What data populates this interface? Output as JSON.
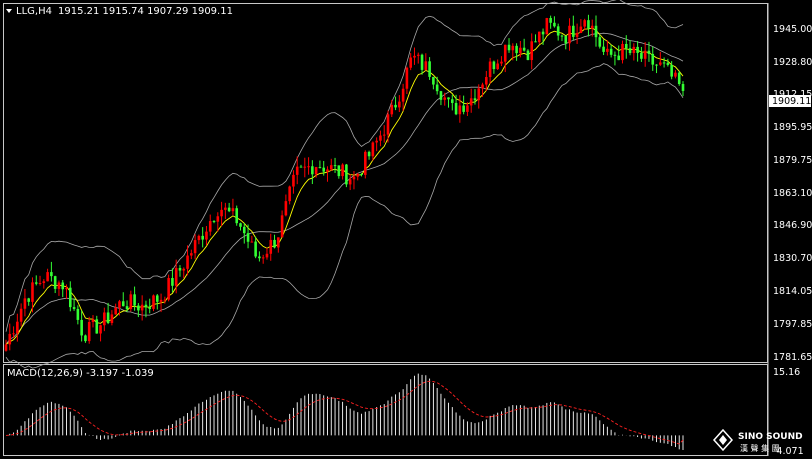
{
  "main_header": {
    "symbol_label": "LLG,H4",
    "ohlc": "1915.21 1915.74 1907.29 1909.11"
  },
  "price_axis": {
    "ticks": [
      "1945.00",
      "1928.80",
      "1912.15",
      "1895.95",
      "1879.75",
      "1863.10",
      "1846.90",
      "1830.70",
      "1814.05",
      "1797.85",
      "1781.65"
    ],
    "current_price": "1909.11"
  },
  "macd": {
    "label": "MACD(12,26,9) -3.197 -1.039",
    "axis_top": "15.16",
    "axis_bottom": "-4.071"
  },
  "logo": {
    "brand": "SINO SOUND",
    "sub": "漢 聲 集 團"
  },
  "colors": {
    "bull": "#ff0000",
    "bear": "#33ff33",
    "band": "#a8a8a8",
    "ma": "#ffff00",
    "signal": "#ff2020",
    "hist": "#ffffff"
  },
  "chart_data": [
    {
      "type": "candlestick",
      "title": "LLG,H4",
      "ylim": [
        1781.65,
        1950
      ],
      "y_ticks": [
        1945.0,
        1928.8,
        1912.15,
        1895.95,
        1879.75,
        1863.1,
        1846.9,
        1830.7,
        1814.05,
        1797.85,
        1781.65
      ],
      "current_price": 1909.11,
      "series_anchor_close": [
        1790,
        1812,
        1822,
        1818,
        1795,
        1800,
        1810,
        1808,
        1812,
        1825,
        1840,
        1855,
        1848,
        1830,
        1840,
        1870,
        1875,
        1872,
        1868,
        1882,
        1900,
        1925,
        1918,
        1900,
        1905,
        1920,
        1932,
        1928,
        1940,
        1935,
        1945,
        1925,
        1928,
        1924,
        1920,
        1909
      ],
      "indicators": [
        "bollinger_bands",
        "moving_average"
      ]
    },
    {
      "type": "bar",
      "title": "MACD(12,26,9)",
      "macd": -3.197,
      "signal": -1.039,
      "ylim": [
        -4.071,
        15.16
      ]
    }
  ]
}
